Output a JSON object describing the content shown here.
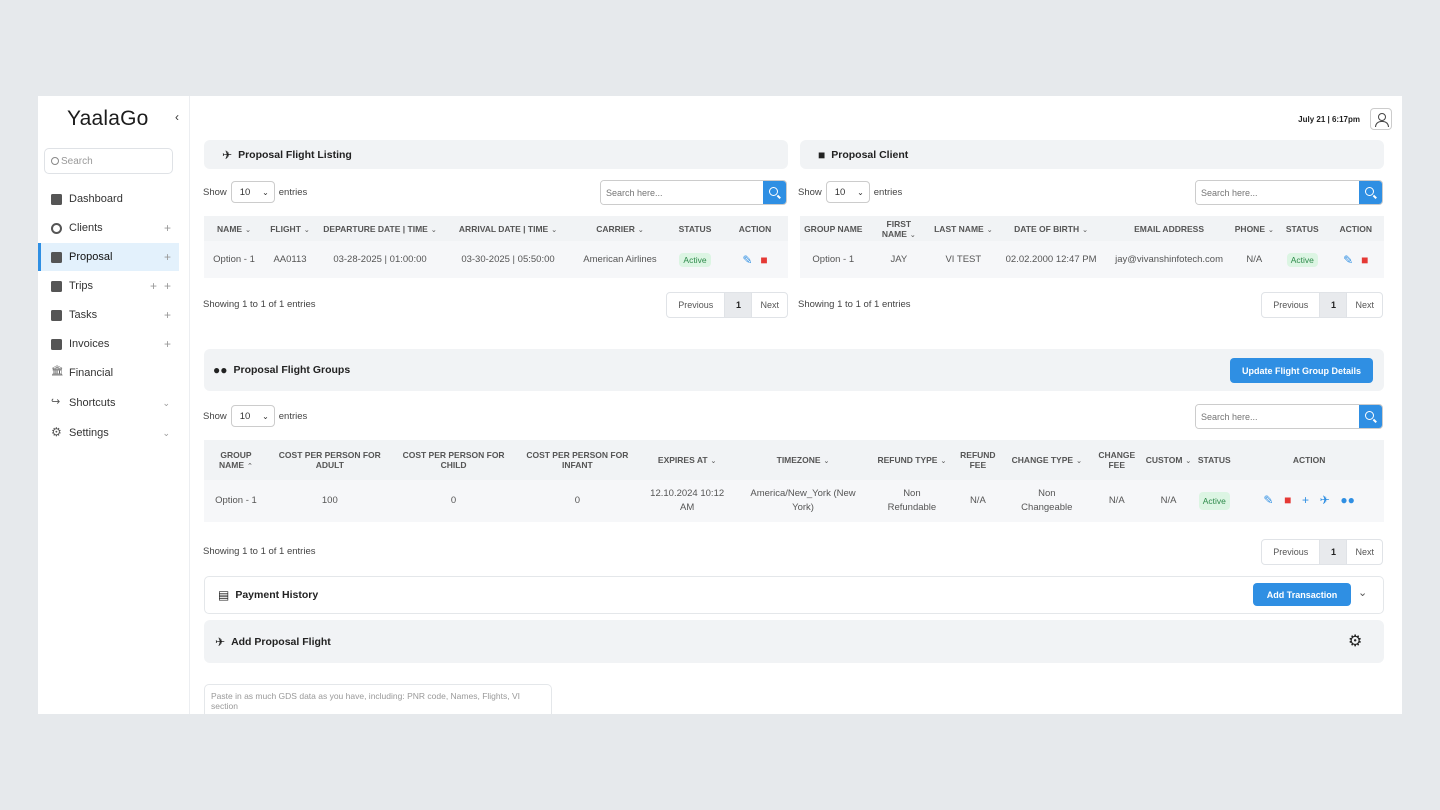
{
  "app": {
    "logo": "YaalaGo",
    "datetime": "July 21 | 6:17pm"
  },
  "sidebar": {
    "search_placeholder": "Search",
    "items": [
      {
        "label": "Dashboard"
      },
      {
        "label": "Clients"
      },
      {
        "label": "Proposal"
      },
      {
        "label": "Trips"
      },
      {
        "label": "Tasks"
      },
      {
        "label": "Invoices"
      },
      {
        "label": "Financial"
      },
      {
        "label": "Shortcuts"
      },
      {
        "label": "Settings"
      }
    ]
  },
  "flight_listing": {
    "title": "Proposal Flight Listing",
    "show": "Show",
    "entries": "entries",
    "page_size": "10",
    "search_placeholder": "Search here...",
    "columns": [
      "NAME",
      "FLIGHT",
      "DEPARTURE DATE | TIME",
      "ARRIVAL DATE | TIME",
      "CARRIER",
      "STATUS",
      "ACTION"
    ],
    "row": {
      "name": "Option - 1",
      "flight": "AA0113",
      "departure": "03-28-2025 | 01:00:00",
      "arrival": "03-30-2025 | 05:50:00",
      "carrier": "American Airlines",
      "status": "Active"
    },
    "info": "Showing 1 to 1 of 1 entries",
    "prev": "Previous",
    "page": "1",
    "next": "Next"
  },
  "client": {
    "title": "Proposal Client",
    "show": "Show",
    "entries": "entries",
    "page_size": "10",
    "search_placeholder": "Search here...",
    "columns": [
      "GROUP NAME",
      "FIRST NAME",
      "LAST NAME",
      "DATE OF BIRTH",
      "EMAIL ADDRESS",
      "PHONE",
      "STATUS",
      "ACTION"
    ],
    "row": {
      "group": "Option - 1",
      "first": "JAY",
      "last": "VI TEST",
      "dob": "02.02.2000 12:47 PM",
      "email": "jay@vivanshinfotech.com",
      "phone": "N/A",
      "status": "Active"
    },
    "info": "Showing 1 to 1 of 1 entries",
    "prev": "Previous",
    "page": "1",
    "next": "Next"
  },
  "flight_groups": {
    "title": "Proposal Flight Groups",
    "update_button": "Update Flight Group Details",
    "show": "Show",
    "entries": "entries",
    "page_size": "10",
    "search_placeholder": "Search here...",
    "columns": {
      "group": [
        "GROUP",
        "NAME"
      ],
      "adult": [
        "COST PER PERSON FOR",
        "ADULT"
      ],
      "child": [
        "COST PER PERSON FOR",
        "CHILD"
      ],
      "infant": [
        "COST PER PERSON FOR",
        "INFANT"
      ],
      "expires": "EXPIRES AT",
      "timezone": "TIMEZONE",
      "refund_type": "REFUND TYPE",
      "refund_fee": [
        "REFUND",
        "FEE"
      ],
      "change_type": "CHANGE TYPE",
      "change_fee": [
        "CHANGE",
        "FEE"
      ],
      "custom": "CUSTOM",
      "status": "STATUS",
      "action": "ACTION"
    },
    "row": {
      "group": "Option - 1",
      "adult": "100",
      "child": "0",
      "infant": "0",
      "expires": [
        "12.10.2024 10:12",
        "AM"
      ],
      "timezone": [
        "America/New_York (New",
        "York)"
      ],
      "refund_type": [
        "Non",
        "Refundable"
      ],
      "refund_fee": "N/A",
      "change_type": [
        "Non",
        "Changeable"
      ],
      "change_fee": "N/A",
      "custom": "N/A",
      "status": "Active"
    },
    "info": "Showing 1 to 1 of 1 entries",
    "prev": "Previous",
    "page": "1",
    "next": "Next"
  },
  "payment": {
    "title": "Payment History",
    "add_button": "Add Transaction"
  },
  "add_flight": {
    "title": "Add Proposal Flight",
    "gds_placeholder": "Paste in as much GDS data as you have, including: PNR code, Names, Flights, VI",
    "gds_more": "section"
  }
}
